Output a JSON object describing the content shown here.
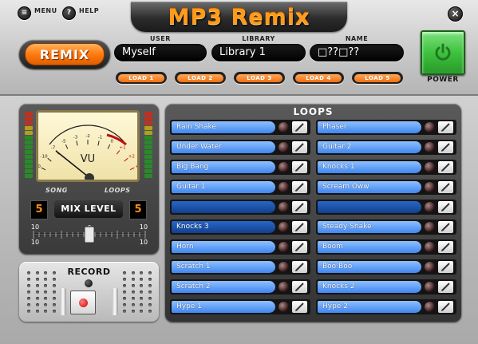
{
  "app": {
    "title": "MP3 Remix"
  },
  "header": {
    "menu_label": "MENU",
    "help_label": "HELP",
    "remix_label": "REMIX",
    "user": {
      "label": "USER",
      "value": "Myself"
    },
    "library": {
      "label": "LIBRARY",
      "value": "Library 1"
    },
    "name": {
      "label": "NAME",
      "value": "□??□??"
    },
    "load_buttons": [
      "LOAD 1",
      "LOAD 2",
      "LOAD 3",
      "LOAD 4",
      "LOAD 5"
    ],
    "power_label": "POWER"
  },
  "meter": {
    "vu_label": "VU",
    "scale": [
      "-20",
      "-10",
      "-7",
      "-5",
      "-3",
      "-2",
      "-1",
      "0",
      "+1",
      "+2",
      "+3"
    ],
    "song_label": "SONG",
    "loops_label": "LOOPS",
    "song_count": "5",
    "loops_count": "5",
    "mix_level_label": "MIX LEVEL",
    "slider_left": "10",
    "slider_right": "10",
    "slider_zero": "0",
    "slider_value_fraction": 0.5
  },
  "record": {
    "label": "RECORD"
  },
  "loops": {
    "title": "LOOPS",
    "left": [
      {
        "name": "Rain Shake",
        "style": "light"
      },
      {
        "name": "Under Water",
        "style": "light"
      },
      {
        "name": "Big Bang",
        "style": "light"
      },
      {
        "name": "Guitar 1",
        "style": "light"
      },
      {
        "name": "",
        "style": "dark"
      },
      {
        "name": "Knocks 3",
        "style": "dark"
      },
      {
        "name": "Horn",
        "style": "light"
      },
      {
        "name": "Scratch 1",
        "style": "light"
      },
      {
        "name": "Scratch 2",
        "style": "light"
      },
      {
        "name": "Hype 1",
        "style": "light"
      }
    ],
    "right": [
      {
        "name": "Phaser",
        "style": "light"
      },
      {
        "name": "Guitar 2",
        "style": "light"
      },
      {
        "name": "Knocks 1",
        "style": "light"
      },
      {
        "name": "Scream Oww",
        "style": "light"
      },
      {
        "name": "",
        "style": "dark"
      },
      {
        "name": "Steady Shake",
        "style": "light"
      },
      {
        "name": "Boom",
        "style": "light"
      },
      {
        "name": "Boo Boo",
        "style": "light"
      },
      {
        "name": "Knocks 2",
        "style": "light"
      },
      {
        "name": "Hype 2",
        "style": "light"
      }
    ]
  },
  "colors": {
    "accent": "#ff8a1a",
    "loop_blue": "#4a8ef5",
    "power_green": "#3ec23e"
  }
}
